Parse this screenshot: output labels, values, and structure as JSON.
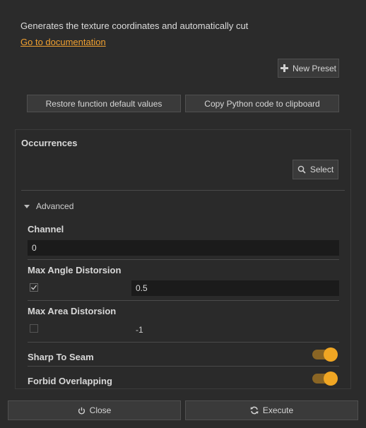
{
  "header": {
    "description": "Generates the texture coordinates and automatically cut",
    "doc_link": "Go to documentation"
  },
  "buttons": {
    "new_preset": "New Preset",
    "restore_defaults": "Restore function default values",
    "copy_python": "Copy Python code to clipboard"
  },
  "occurrences": {
    "title": "Occurrences",
    "select_label": "Select"
  },
  "advanced": {
    "label": "Advanced",
    "expanded": true
  },
  "params": {
    "channel": {
      "label": "Channel",
      "value": "0"
    },
    "max_angle": {
      "label": "Max Angle Distorsion",
      "checked": true,
      "value": "0.5"
    },
    "max_area": {
      "label": "Max Area Distorsion",
      "checked": false,
      "value": "-1"
    },
    "sharp_to_seam": {
      "label": "Sharp To Seam",
      "on": true
    },
    "forbid_overlapping": {
      "label": "Forbid Overlapping",
      "on": true
    }
  },
  "footer": {
    "close_label": "Close",
    "execute_label": "Execute"
  },
  "colors": {
    "accent": "#f0a623",
    "link": "#f0a030",
    "background": "#2b2b2b"
  }
}
